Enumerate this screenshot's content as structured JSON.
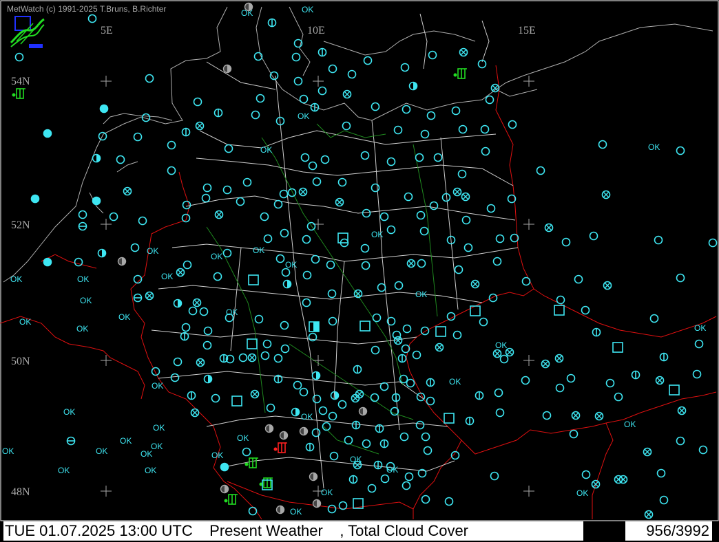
{
  "app": {
    "credit": "MetWatch  (c) 1991-2025 T.Bruns, B.Richter"
  },
  "status_bar": {
    "datetime": "TUE 01.07.2025 13:00 UTC",
    "product": "Present Weather",
    "product2": ", Total Cloud Cover",
    "station_count": "956/3992"
  },
  "map": {
    "longitude_labels": [
      "5E",
      "10E",
      "15E"
    ],
    "latitude_labels": [
      "54N",
      "52N",
      "50N",
      "48N"
    ],
    "ok_label": "OK",
    "colors": {
      "background": "#000000",
      "station": "#3ee6f2",
      "coast": "#b0b0b0",
      "country_border": "#e01010",
      "state_border": "#cfcfcf",
      "river": "#1f8a1f",
      "precip_green": "#22dd22",
      "precip_red": "#ff2020",
      "grey_station": "#a8a8a8"
    }
  }
}
